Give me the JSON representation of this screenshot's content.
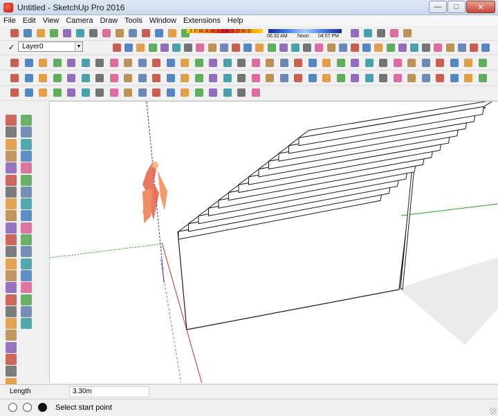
{
  "window": {
    "title": "Untitled - SketchUp Pro 2016",
    "minimize": "—",
    "maximize": "□",
    "close": "✕"
  },
  "menu": [
    "File",
    "Edit",
    "View",
    "Camera",
    "Draw",
    "Tools",
    "Window",
    "Extensions",
    "Help"
  ],
  "shadow": {
    "months": [
      "J",
      "F",
      "M",
      "A",
      "M",
      "J",
      "J",
      "A",
      "S",
      "O",
      "N",
      "D"
    ],
    "time_start": "06:32 AM",
    "time_noon": "Noon",
    "time_end": "04:57 PM"
  },
  "layer": {
    "current": "Layer0"
  },
  "measurement": {
    "label": "Length",
    "value": "3.30m"
  },
  "status": {
    "hint": "Select start point"
  },
  "colors": {
    "axis_red": "#d62a2a",
    "axis_green": "#1ea31e",
    "axis_blue": "#2730c8",
    "shadow": "#ebebeb",
    "stair_edge": "#1a1a1a",
    "figure": "#e44a2a"
  },
  "icons": {
    "row1": [
      "new-icon",
      "open-icon",
      "cut-icon",
      "copy-icon",
      "paste-icon",
      "erase-icon",
      "undo-icon",
      "redo-icon",
      "print-icon",
      "model-info-icon",
      "shadows-toggle-icon",
      "shadow-slider-icon",
      "fog-icon",
      "3d-warehouse-icon",
      "extension-warehouse-icon",
      "layout-icon",
      "components-icon",
      "materials-icon",
      "styles-icon"
    ],
    "row2": [
      "layer-manager-icon",
      "iso-view-icon",
      "top-view-icon",
      "front-view-icon",
      "right-view-icon",
      "back-view-icon",
      "left-view-icon",
      "select-icon",
      "make-component-icon",
      "paint-bucket-icon",
      "eraser-icon",
      "tape-measure-icon",
      "protractor-icon",
      "text-icon",
      "axes-icon",
      "dimension-icon",
      "3d-text-icon",
      "section-plane-icon",
      "walk-icon",
      "look-around-icon",
      "position-camera-icon",
      "orbit-icon",
      "pan-icon",
      "zoom-icon",
      "zoom-extents-icon",
      "x-ray-icon",
      "wireframe-icon",
      "hidden-line-icon",
      "shaded-icon",
      "textured-icon",
      "monochrome-icon",
      "ruby-console-icon"
    ],
    "row3": [
      "line-icon",
      "freehand-icon",
      "rectangle-icon",
      "rotated-rect-icon",
      "circle-icon",
      "polygon-icon",
      "arc-icon",
      "pie-icon",
      "move-icon",
      "push-pull-icon",
      "rotate-icon",
      "follow-me-icon",
      "scale-icon",
      "offset-icon",
      "sandbox-smoove-icon",
      "from-contours-icon",
      "drape-icon",
      "add-detail-icon",
      "flip-edge-icon",
      "solid-union-icon",
      "solid-subtract-icon",
      "solid-trim-icon",
      "shell-icon"
    ],
    "row4": [
      "previous-view-icon",
      "next-view-icon",
      "standard-views-icon",
      "parallel-projection-icon",
      "perspective-icon",
      "two-point-icon",
      "match-photo-icon",
      "edit-match-photo-icon",
      "section-display-icon",
      "section-fill-icon",
      "back-edges-icon",
      "hide-icon",
      "unhide-icon",
      "dynamic-components-icon",
      "interact-icon",
      "component-options-icon",
      "component-attributes-icon",
      "location-icon",
      "toggle-terrain-icon",
      "add-location-icon",
      "photo-textures-icon"
    ]
  }
}
